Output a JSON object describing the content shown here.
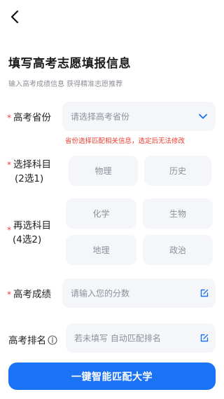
{
  "header": {
    "title": "填写高考志愿填报信息",
    "subtitle": "输入高考成绩信息 获得精准志愿推荐"
  },
  "required_mark": "*",
  "province": {
    "label": "高考省份",
    "placeholder": "请选择高考省份",
    "hint": "省份选择匹配相关信息，选定后无法修改"
  },
  "subject_select": {
    "label_line1": "选择科目",
    "label_line2": "(2选1)",
    "options": [
      "物理",
      "历史"
    ]
  },
  "reselect": {
    "label_line1": "再选科目",
    "label_line2": "(4选2)",
    "options": [
      "化学",
      "生物",
      "地理",
      "政治"
    ]
  },
  "score": {
    "label": "高考成绩",
    "placeholder": "请输入您的分数"
  },
  "rank": {
    "label": "高考排名",
    "placeholder": "若未填写 自动匹配排名"
  },
  "submit_label": "一键智能匹配大学",
  "colors": {
    "accent": "#1a73f5",
    "required": "#f0453a",
    "field_bg": "#f4f6f9"
  }
}
